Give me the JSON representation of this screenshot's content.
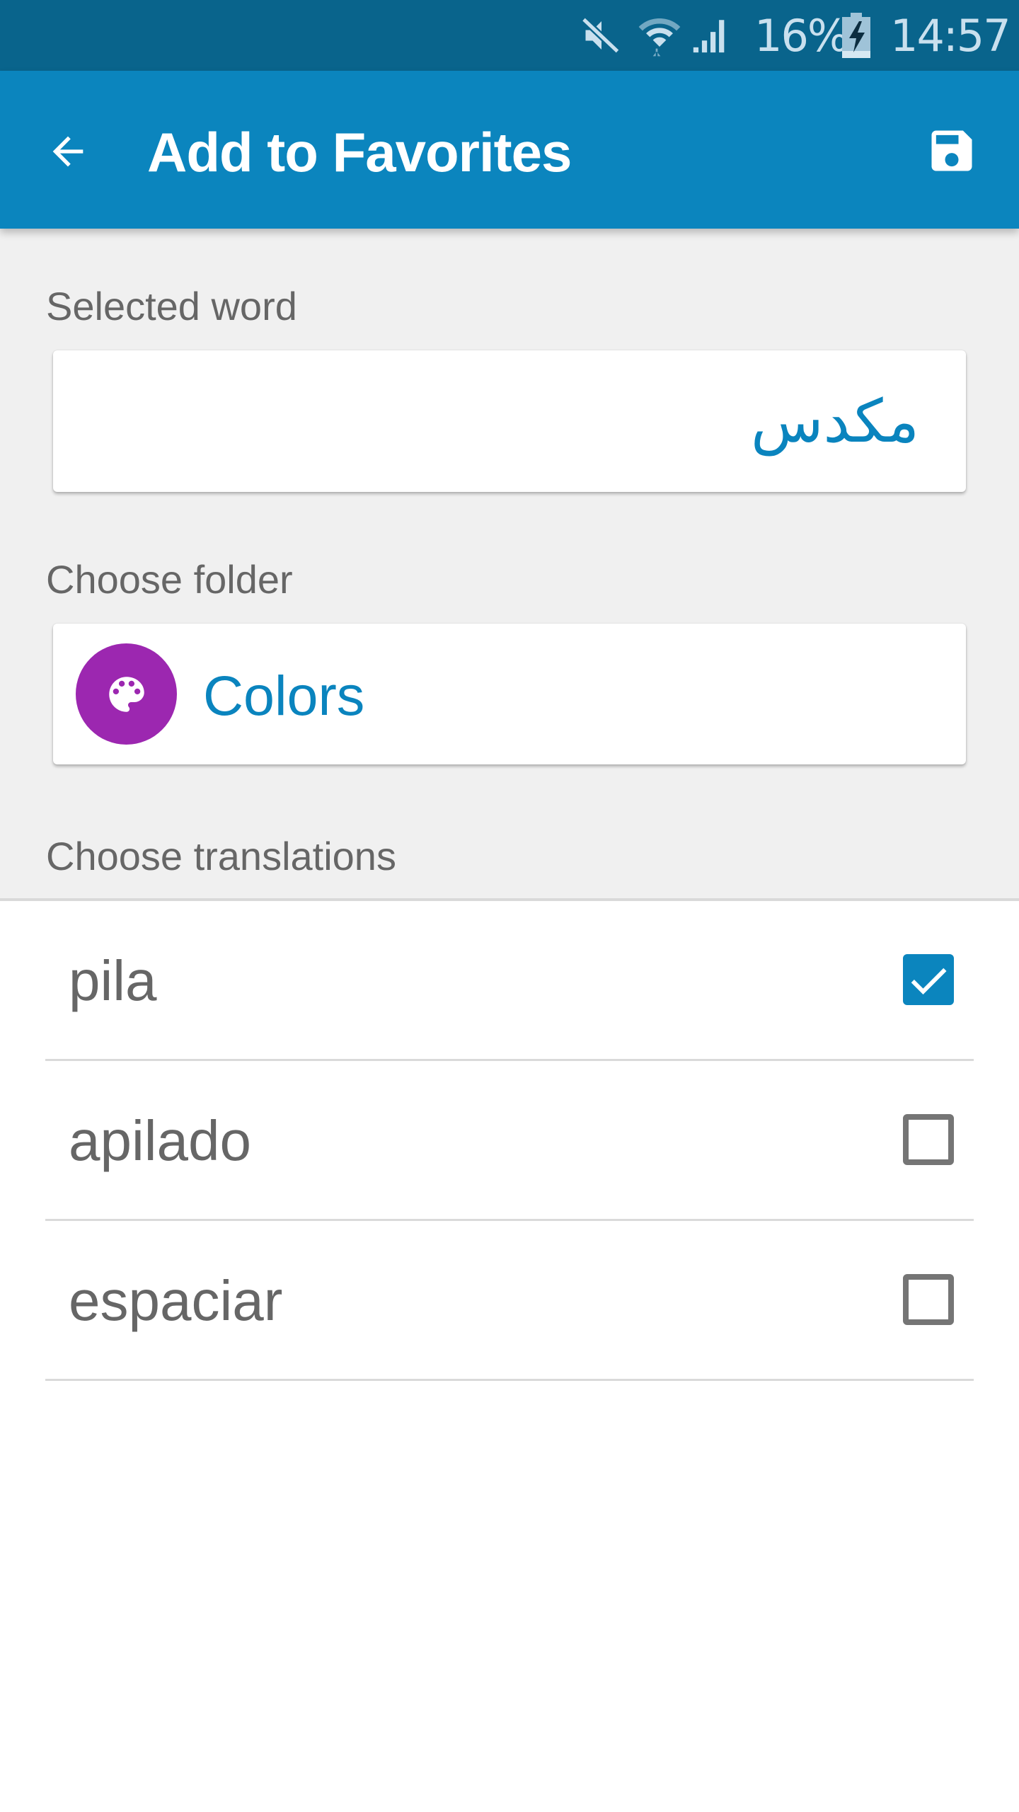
{
  "status_bar": {
    "icons": [
      "mute-icon",
      "wifi-icon",
      "cellular-signal-icon",
      "battery-charging-icon"
    ],
    "battery_percent": "16%",
    "time": "14:57"
  },
  "toolbar": {
    "back_icon": "arrow-back-icon",
    "title": "Add to Favorites",
    "save_icon": "floppy-save-icon"
  },
  "selected_word": {
    "label": "Selected word",
    "value": "مكدس"
  },
  "folder": {
    "label": "Choose folder",
    "icon": "palette-icon",
    "icon_color": "#9C27B0",
    "name": "Colors"
  },
  "translations": {
    "label": "Choose translations",
    "items": [
      {
        "text": "pila",
        "checked": true
      },
      {
        "text": "apilado",
        "checked": false
      },
      {
        "text": "espaciar",
        "checked": false
      }
    ]
  },
  "colors": {
    "status_bar": "#09648C",
    "primary": "#0B85BE",
    "accent_text": "#0A84BE",
    "label_gray": "#666666",
    "background": "#F0F0F0"
  }
}
